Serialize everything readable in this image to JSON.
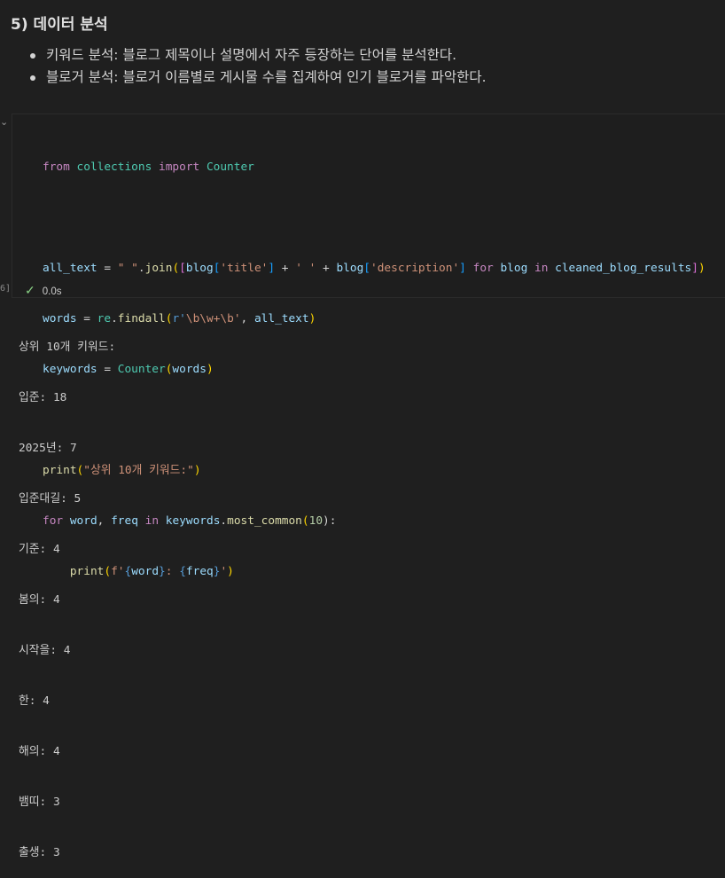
{
  "markdown": {
    "heading": "5) 데이터 분석",
    "bullets": [
      "키워드 분석: 블로그 제목이나 설명에서 자주 등장하는 단어를 분석한다.",
      "블로거 분석: 블로거 이름별로 게시물 수를 집계하여 인기 블로거를 파악한다."
    ]
  },
  "cell": {
    "execution_count": "6]",
    "status_time": "0.0s",
    "code": {
      "l1": [
        "from",
        " collections ",
        "import",
        " Counter"
      ],
      "l3": [
        "all_text",
        " = ",
        "\" \"",
        ".",
        "join",
        "(",
        "[",
        "blog",
        "[",
        "'title'",
        "]",
        " + ",
        "' '",
        " + ",
        "blog",
        "[",
        "'description'",
        "]",
        " ",
        "for",
        " ",
        "blog",
        " ",
        "in",
        " ",
        "cleaned_blog_results",
        "]",
        ")"
      ],
      "l4": [
        "words",
        " = ",
        "re",
        ".",
        "findall",
        "(",
        "r'",
        "\\b\\w+\\b",
        "'",
        ", ",
        "all_text",
        ")"
      ],
      "l5": [
        "keywords",
        " = ",
        "Counter",
        "(",
        "words",
        ")"
      ],
      "l7": [
        "print",
        "(",
        "\"상위 10개 키워드:\"",
        ")"
      ],
      "l8": [
        "for",
        " ",
        "word",
        ", ",
        "freq",
        " ",
        "in",
        " ",
        "keywords",
        ".",
        "most_common",
        "(",
        "10",
        "):"
      ],
      "l9": [
        "    ",
        "print",
        "(",
        "f'",
        "{",
        "word",
        "}",
        ": ",
        "{",
        "freq",
        "}",
        "'",
        ")"
      ]
    },
    "output": [
      "상위 10개 키워드:",
      "입준: 18",
      "2025년: 7",
      "입준대길: 5",
      "기준: 4",
      "봄의: 4",
      "시작을: 4",
      "한: 4",
      "해의: 4",
      "뱀띠: 3",
      "출생: 3"
    ]
  }
}
